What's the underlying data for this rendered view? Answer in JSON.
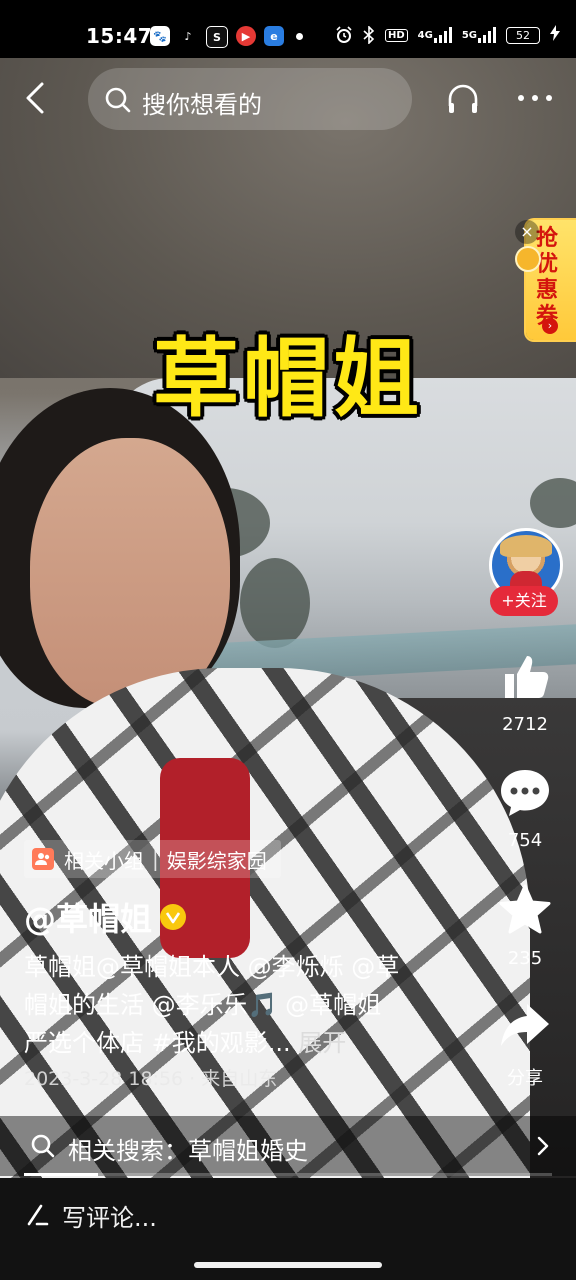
{
  "status_bar": {
    "time": "15:47",
    "app_icons": [
      "baidu-icon",
      "tiktok-icon",
      "sf-icon",
      "youtube-icon",
      "browser-icon"
    ],
    "hd_label": "HD",
    "network": "4G",
    "network2": "5G",
    "battery": "52"
  },
  "top_bar": {
    "search_placeholder": "搜你想看的"
  },
  "coupon": {
    "text": "抢优惠券"
  },
  "video": {
    "overlay_title": "草帽姐"
  },
  "actions": {
    "follow_label": "+关注",
    "like_count": "2712",
    "comment_count": "754",
    "favorite_count": "235",
    "share_label": "分享"
  },
  "info": {
    "group_label": "相关小组",
    "group_name": "娱影综家园",
    "author": "@草帽姐",
    "desc_line1": "草帽姐@草帽姐本人 @李烁烁 @草",
    "desc_line2": "帽姐的生活 @李乐乐🎵 @草帽姐",
    "desc_line3": "严选个体店 #我的观影...",
    "desc_more": "展开",
    "date_loc": "2023-3-28 18:56 · 来自山东"
  },
  "related_search": {
    "text": "相关搜索：草帽姐婚史"
  },
  "progress": 0.14,
  "comment_bar": {
    "placeholder": "写评论..."
  },
  "colors": {
    "title_yellow": "#ffe816",
    "follow_red": "#e52a3a",
    "coupon_red": "#d4150d"
  }
}
